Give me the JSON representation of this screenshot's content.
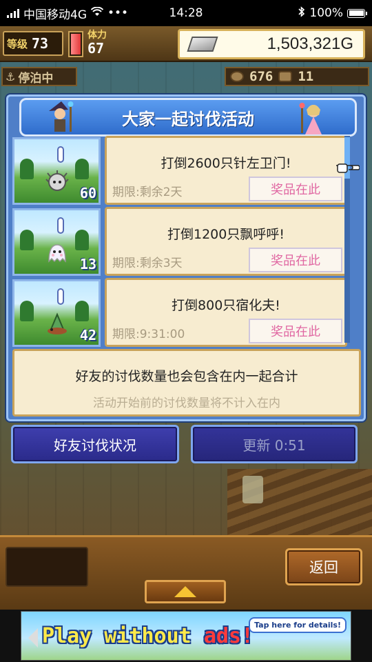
{
  "status_bar": {
    "carrier": "中国移动4G",
    "dots": "•••",
    "time": "14:28",
    "battery": "100%"
  },
  "hud": {
    "level_label": "等级",
    "level_value": "73",
    "stamina_label": "体力",
    "stamina_value": "67",
    "money": "1,503,321G",
    "docked_label": "停泊中",
    "resource_1": "676",
    "resource_2": "11"
  },
  "panel": {
    "title": "大家一起讨伐活动",
    "quests": [
      {
        "title": "打倒2600只针左卫门!",
        "deadline": "期限:剩余2天",
        "prize_label": "奖品在此",
        "count": "60"
      },
      {
        "title": "打倒1200只飘呼呼!",
        "deadline": "期限:剩余3天",
        "prize_label": "奖品在此",
        "count": "13"
      },
      {
        "title": "打倒800只宿化夫!",
        "deadline": "期限:9:31:00",
        "prize_label": "奖品在此",
        "count": "42"
      }
    ],
    "note_main": "好友的讨伐数量也会包含在内一起合计",
    "note_sub": "活动开始前的讨伐数量将不计入在内"
  },
  "buttons": {
    "friend_status": "好友讨伐状况",
    "refresh": "更新 0:51",
    "back": "返回"
  },
  "ad": {
    "text_a": "Play without ",
    "text_b": "ads!",
    "tap": "Tap here for details!"
  },
  "colors": {
    "panel_blue": "#4f7fc8",
    "card_bg": "#f7ecd0",
    "prize_text": "#e067a2"
  }
}
